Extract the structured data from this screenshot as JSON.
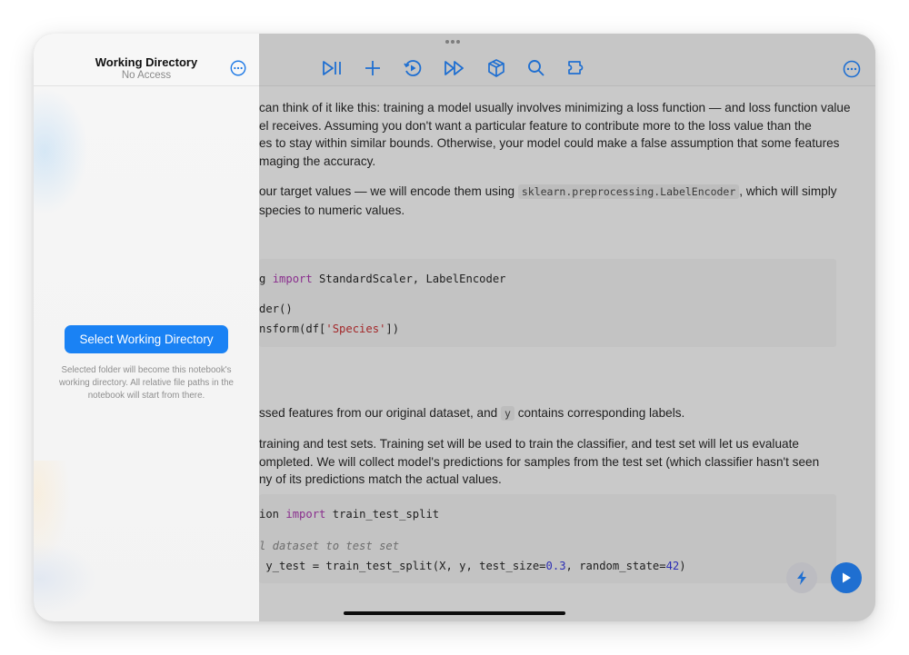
{
  "sidebar": {
    "title": "Working Directory",
    "subtitle": "No Access",
    "select_button_label": "Select Working Directory",
    "help_text": "Selected folder will become this notebook's working directory. All relative file paths in the notebook will start from there."
  },
  "toolbar": {
    "icons": [
      "run-pause-icon",
      "add-cell-icon",
      "restart-run-icon",
      "run-all-icon",
      "packages-icon",
      "search-icon",
      "extensions-icon"
    ],
    "more_icon": "more-icon"
  },
  "notebook": {
    "paragraph1": [
      "can think of it like this: training a model usually involves minimizing a loss function — and loss function value",
      "el receives. Assuming you don't want a particular feature to contribute more to the loss value than the",
      "es to stay within similar bounds. Otherwise, your model could make a false assumption that some features",
      "maging the accuracy."
    ],
    "paragraph2": {
      "line1_before": " our target values — we will encode them using ",
      "line1_code": "sklearn.preprocessing.LabelEncoder",
      "line1_after": ", which will simply",
      "line2": "species to numeric values."
    },
    "code1": {
      "line1_prefix": "g ",
      "line1_kw": "import",
      "line1_rest": " StandardScaler, LabelEncoder",
      "line2": "der()",
      "line3_prefix": "nsform(df[",
      "line3_str": "'Species'",
      "line3_suffix": "])"
    },
    "paragraph3": {
      "before": "ssed features from our original dataset, and ",
      "code": "y",
      "after": " contains corresponding labels."
    },
    "paragraph4": [
      " training and test sets. Training set will be used to train the classifier, and test set will let us evaluate",
      "ompleted. We will collect model's predictions for samples from the test set (which classifier hasn't seen",
      "ny of its predictions match the actual values."
    ],
    "code2": {
      "line1_prefix": "ion ",
      "line1_kw": "import",
      "line1_rest": " train_test_split",
      "comment": "l dataset to test set",
      "line3_prefix": " y_test = train_test_split(X, y, test_size=",
      "line3_num1": "0.3",
      "line3_mid": ", random_state=",
      "line3_num2": "42",
      "line3_suffix": ")"
    }
  },
  "fabs": {
    "bolt": "bolt-icon",
    "run": "play-icon"
  },
  "colors": {
    "accent": "#1f6fd1",
    "button": "#1a82f4"
  }
}
